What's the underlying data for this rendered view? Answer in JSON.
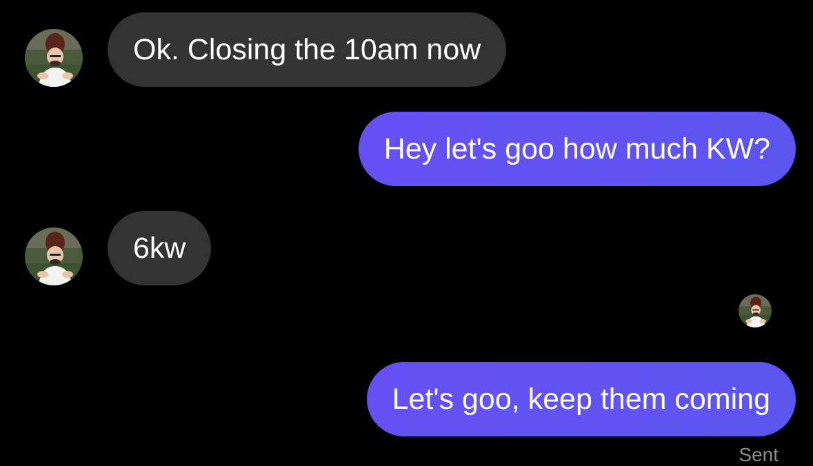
{
  "conversation": {
    "messages": [
      {
        "direction": "incoming",
        "text": "Ok. Closing the 10am now",
        "avatar_icon": "contact-avatar-icon"
      },
      {
        "direction": "outgoing",
        "text": "Hey let's goo how much KW?"
      },
      {
        "direction": "incoming",
        "text": "6kw",
        "avatar_icon": "contact-avatar-icon"
      },
      {
        "direction": "outgoing",
        "text": "Let's goo, keep them coming",
        "read_receipt_icon": "read-receipt-avatar-icon"
      }
    ],
    "status_text": "Sent"
  },
  "colors": {
    "background": "#000000",
    "incoming_bubble": "#333333",
    "outgoing_bubble": "#6152F2",
    "text": "#FFFFFF",
    "status_text": "#8E8E93"
  }
}
